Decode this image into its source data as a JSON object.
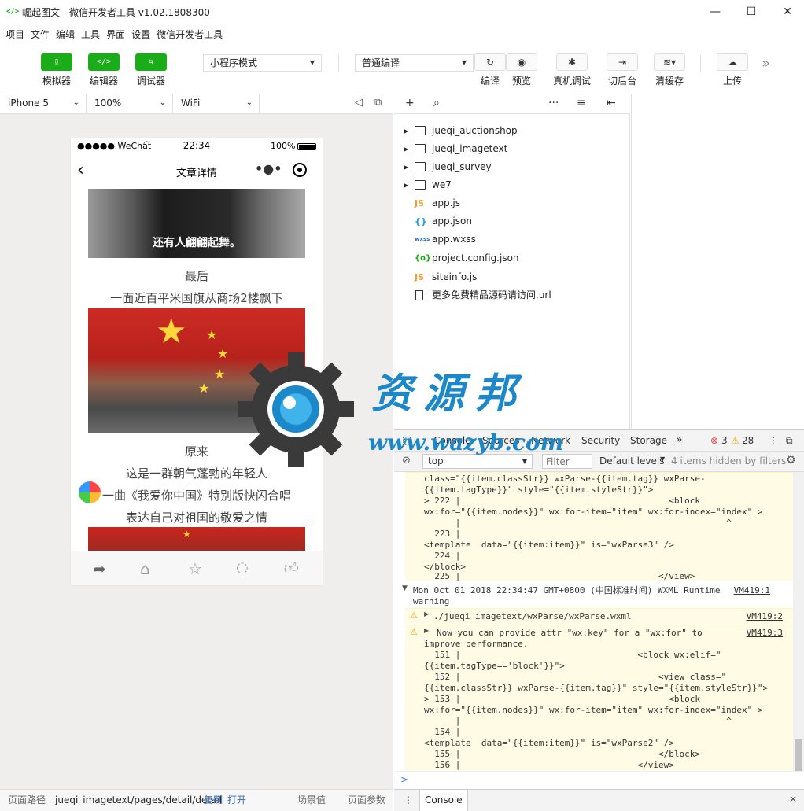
{
  "window": {
    "title": "崛起图文 - 微信开发者工具 v1.02.1808300",
    "logo": "</>",
    "minimize": "—",
    "maximize": "☐",
    "close": "✕"
  },
  "menu": [
    "项目",
    "文件",
    "编辑",
    "工具",
    "界面",
    "设置",
    "微信开发者工具"
  ],
  "toolbar": {
    "simulator": "模拟器",
    "editor": "编辑器",
    "debugger": "调试器",
    "mode_select": "小程序模式",
    "compile_select": "普通编译",
    "compile": "编译",
    "preview": "预览",
    "remote_debug": "真机调试",
    "background": "切后台",
    "clear_cache": "清缓存",
    "upload": "上传",
    "more": "»"
  },
  "device_bar": {
    "device": "iPhone 5",
    "zoom": "100%",
    "network": "WiFi"
  },
  "phone": {
    "carrier": "●●●●● WeChat",
    "time": "22:34",
    "battery": "100%",
    "page_title": "文章详情",
    "caption_1": "还有人翩翩起舞。",
    "text_1": "最后",
    "text_2": "一面近百平米国旗从商场2楼飘下",
    "text_3": "原来",
    "text_4": "这是一群朝气蓬勃的年轻人",
    "text_5": "一曲《我爱你中国》特别版快闪合唱",
    "text_6": "表达自己对祖国的敬爱之情"
  },
  "pathbar": {
    "label": "页面路径",
    "path": "jueqi_imagetext/pages/detail/detail",
    "copy": "复制",
    "open": "打开",
    "scene": "场景值",
    "params": "页面参数"
  },
  "tree": {
    "items": [
      {
        "name": "jueqi_auctionshop",
        "type": "folder"
      },
      {
        "name": "jueqi_imagetext",
        "type": "folder"
      },
      {
        "name": "jueqi_survey",
        "type": "folder"
      },
      {
        "name": "we7",
        "type": "folder"
      },
      {
        "name": "app.js",
        "type": "js"
      },
      {
        "name": "app.json",
        "type": "json"
      },
      {
        "name": "app.wxss",
        "type": "wxss"
      },
      {
        "name": "project.config.json",
        "type": "config"
      },
      {
        "name": "siteinfo.js",
        "type": "js"
      },
      {
        "name": "更多免费精品源码请访问.url",
        "type": "file"
      }
    ]
  },
  "devtools": {
    "tabs": [
      "Console",
      "Sources",
      "Network",
      "Security",
      "Storage"
    ],
    "error_count": "3",
    "warning_count": "28",
    "context": "top",
    "filter_placeholder": "Filter",
    "levels": "Default levels",
    "hidden": "4 items hidden by filters",
    "console_lines_top": [
      "class=\"{{item.classStr}} wxParse-{{item.tag}} wxParse-",
      "{{item.tagType}}\" style=\"{{item.styleStr}}\">",
      "> 222 |                                        <block",
      "wx:for=\"{{item.nodes}}\" wx:for-item=\"item\" wx:for-index=\"index\" >",
      "      |                                                   ^",
      "  223 |",
      "<template  data=\"{{item:item}}\" is=\"wxParse3\" />",
      "  224 |",
      "</block>",
      "  225 |                                      </view>"
    ],
    "group_header": "Mon Oct 01 2018 22:34:47 GMT+0800 (中国标准时间) WXML Runtime",
    "group_header_2": "warning",
    "group_link": "VM419:1",
    "warn1": "./jueqi_imagetext/wxParse/wxParse.wxml",
    "warn1_link": "VM419:2",
    "warn2_lines": [
      "Now you can provide attr \"wx:key\" for a \"wx:for\" to",
      "improve performance.",
      "  151 |                                  <block wx:elif=\"",
      "{{item.tagType=='block'}}\">",
      "  152 |                                      <view class=\"",
      "{{item.classStr}} wxParse-{{item.tag}}\" style=\"{{item.styleStr}}\">",
      "> 153 |                                        <block",
      "wx:for=\"{{item.nodes}}\" wx:for-item=\"item\" wx:for-index=\"index\" >",
      "      |                                                   ^",
      "  154 |",
      "<template  data=\"{{item:item}}\" is=\"wxParse2\" />",
      "  155 |                                      </block>",
      "  156 |                                  </view>"
    ],
    "warn2_link": "VM419:3",
    "prompt": ">",
    "drawer_tab": "Console"
  },
  "watermark": {
    "title": "资源邦",
    "url": "www.wazyb.com"
  }
}
